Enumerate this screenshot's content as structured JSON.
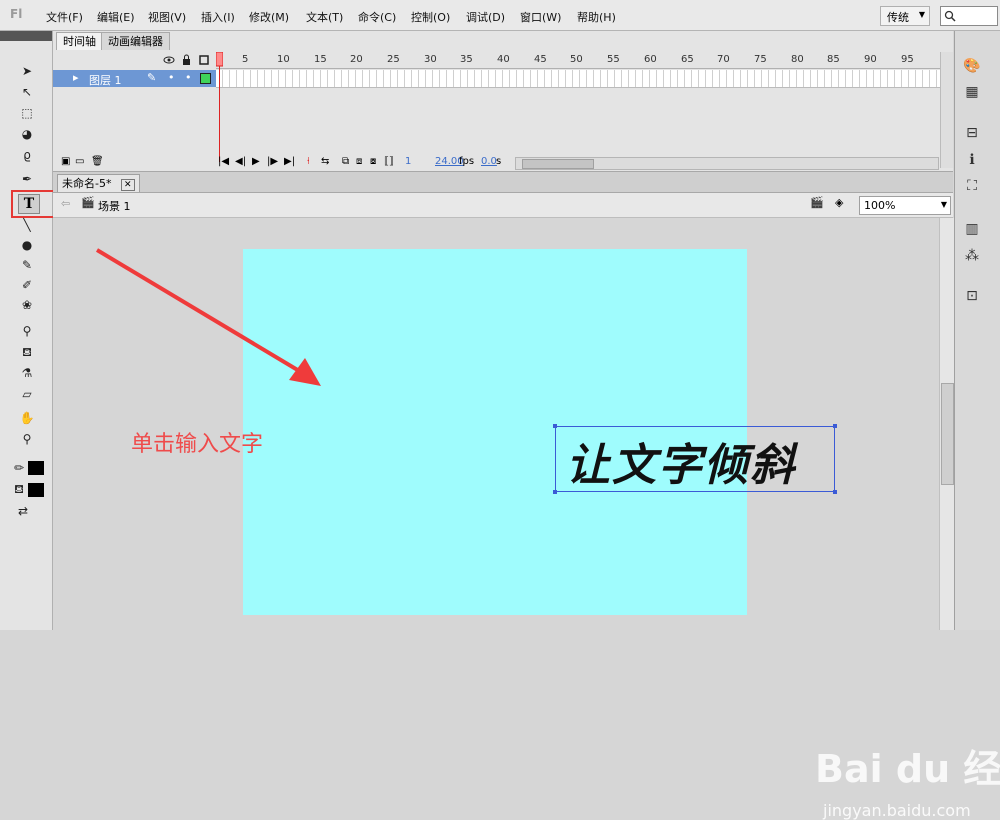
{
  "menubar": {
    "logo": "Fl",
    "items": [
      "文件(F)",
      "编辑(E)",
      "视图(V)",
      "插入(I)",
      "修改(M)",
      "文本(T)",
      "命令(C)",
      "控制(O)",
      "调试(D)",
      "窗口(W)",
      "帮助(H)"
    ],
    "workspace": "传统",
    "workspace_arrow": "▼"
  },
  "timeline": {
    "tabs": [
      "时间轴",
      "动画编辑器"
    ],
    "frame_numbers": [
      "1",
      "5",
      "10",
      "15",
      "20",
      "25",
      "30",
      "35",
      "40",
      "45",
      "50",
      "55",
      "60",
      "65",
      "70",
      "75",
      "80",
      "85",
      "90",
      "95"
    ],
    "layer_name": "图层 1",
    "fps": "24.00",
    "fps_unit": "fps",
    "time": "0.0",
    "time_unit": "s",
    "current_frame": "1"
  },
  "document": {
    "tab_label": "未命名-5*",
    "scene_label": "场景 1",
    "zoom": "100%"
  },
  "stage": {
    "text": "让文字倾斜",
    "annotation": "单击输入文字",
    "background_color": "#9ffcfd"
  },
  "watermark": {
    "brand": "Bai du 经验",
    "url": "jingyan.baidu.com"
  },
  "colors": {
    "highlight": "#e53935",
    "layer_selected": "#6d97d4",
    "annotation": "#ef4b4b"
  }
}
